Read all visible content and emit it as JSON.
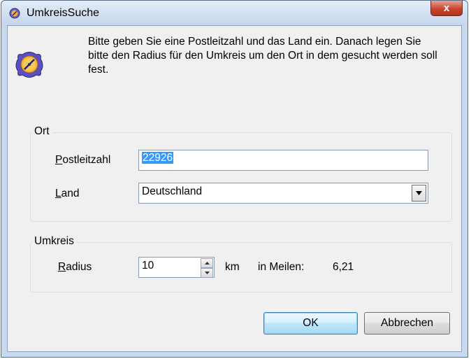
{
  "window": {
    "title": "UmkreisSuche",
    "close_label": "x"
  },
  "intro_text": "Bitte geben Sie eine Postleitzahl und das Land ein. Danach legen Sie bitte den Radius für den Umkreis um den Ort in dem gesucht werden soll fest.",
  "ort": {
    "group_label": "Ort",
    "postleitzahl_label_first": "P",
    "postleitzahl_label_rest": "ostleitzahl",
    "postleitzahl_value": "22926",
    "land_label_first": "L",
    "land_label_rest": "and",
    "land_value": "Deutschland"
  },
  "umkreis": {
    "group_label": "Umkreis",
    "radius_label_first": "R",
    "radius_label_rest": "adius",
    "radius_value": "10",
    "unit": "km",
    "miles_label": "in Meilen:",
    "miles_value": "6,21"
  },
  "buttons": {
    "ok": "OK",
    "cancel": "Abbrechen"
  },
  "icons": {
    "app": "compass-icon",
    "title": "compass-icon"
  }
}
